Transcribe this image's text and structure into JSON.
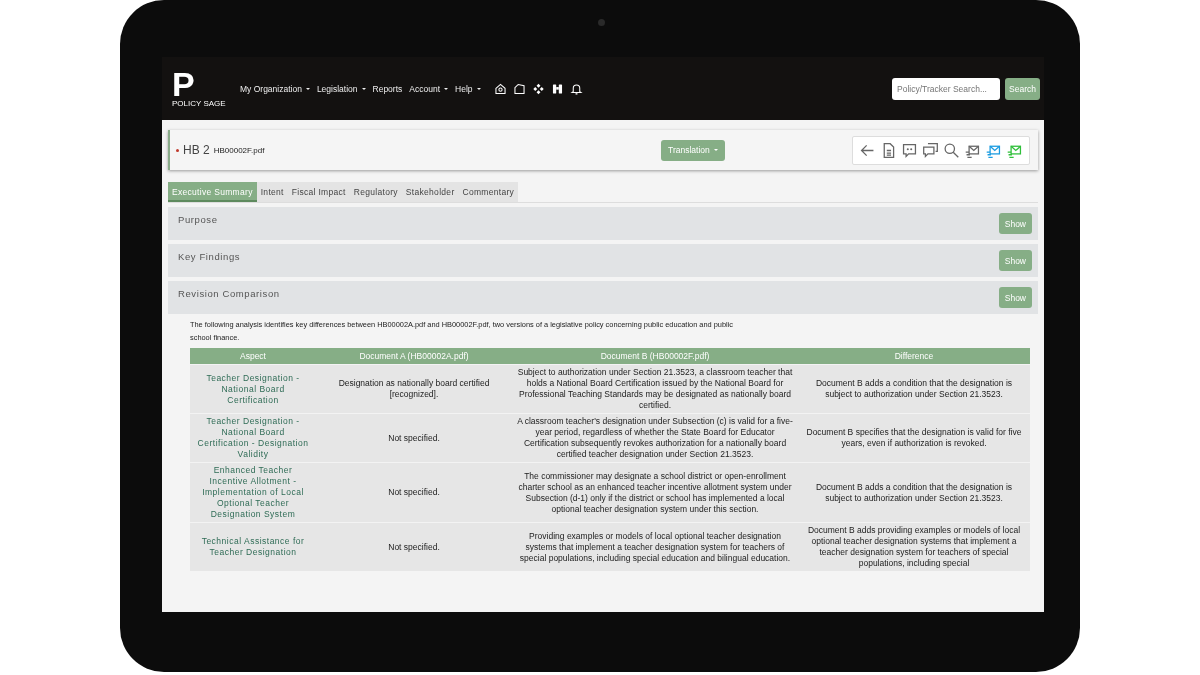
{
  "header": {
    "logo": {
      "mark": "P",
      "caption": "POLICY SAGE"
    },
    "nav": [
      {
        "label": "My Organization",
        "dropdown": true
      },
      {
        "label": "Legislation",
        "dropdown": true
      },
      {
        "label": "Reports",
        "dropdown": false
      },
      {
        "label": "Account",
        "dropdown": true
      },
      {
        "label": "Help",
        "dropdown": true
      }
    ],
    "search": {
      "placeholder": "Policy/Tracker Search...",
      "button": "Search"
    }
  },
  "document": {
    "title": "HB 2",
    "file": "HB00002F.pdf",
    "translation": "Translation"
  },
  "tabs": [
    {
      "label": "Executive Summary",
      "selected": true
    },
    {
      "label": "Intent",
      "selected": false
    },
    {
      "label": "Fiscal Impact",
      "selected": false
    },
    {
      "label": "Regulatory",
      "selected": false
    },
    {
      "label": "Stakeholder",
      "selected": false
    },
    {
      "label": "Commentary",
      "selected": false
    }
  ],
  "sections": [
    {
      "title": "Purpose",
      "button": "Show"
    },
    {
      "title": "Key Findings",
      "button": "Show"
    },
    {
      "title": "Revision Comparison",
      "button": "Show"
    }
  ],
  "intro": "The following analysis identifies key differences between HB00002A.pdf and HB00002F.pdf, two versions of a legislative policy concerning public education and public school finance.",
  "table": {
    "columns": [
      "Aspect",
      "Document A (HB00002A.pdf)",
      "Document B (HB00002F.pdf)",
      "Difference"
    ],
    "rows": [
      [
        "Teacher Designation - National Board Certification",
        "Designation as nationally board certified [recognized].",
        "Subject to authorization under Section 21.3523, a classroom teacher that holds a National Board Certification issued by the National Board for Professional Teaching Standards may be designated as nationally board certified.",
        "Document B adds a condition that the designation is subject to authorization under Section 21.3523."
      ],
      [
        "Teacher Designation - National Board Certification - Designation Validity",
        "Not specified.",
        "A classroom teacher's designation under Subsection (c) is valid for a five-year period, regardless of whether the State Board for Educator Certification subsequently revokes authorization for a nationally board certified teacher designation under Section 21.3523.",
        "Document B specifies that the designation is valid for five years, even if authorization is revoked."
      ],
      [
        "Enhanced Teacher Incentive Allotment - Implementation of Local Optional Teacher Designation System",
        "Not specified.",
        "The commissioner may designate a school district or open-enrollment charter school as an enhanced teacher incentive allotment system under Subsection (d-1) only if the district or school has implemented a local optional teacher designation system under this section.",
        "Document B adds a condition that the designation is subject to authorization under Section 21.3523."
      ],
      [
        "Technical Assistance for Teacher Designation",
        "Not specified.",
        "Providing examples or models of local optional teacher designation systems that implement a teacher designation system for teachers of special populations, including special education and bilingual education.",
        "Document B adds providing examples or models of local optional teacher designation systems that implement a teacher designation system for teachers of special populations, including special"
      ]
    ]
  }
}
